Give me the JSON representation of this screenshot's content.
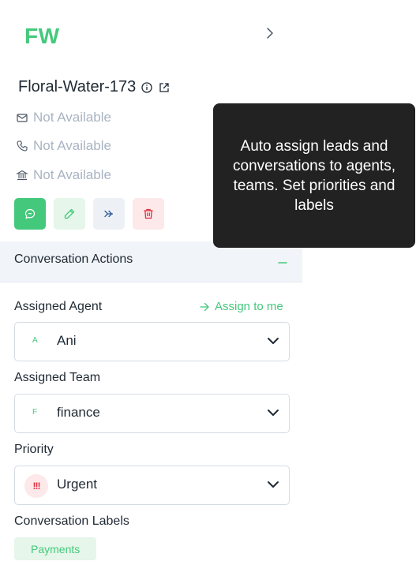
{
  "contact": {
    "initials": "FW",
    "name": "Floral-Water-173",
    "email": "Not Available",
    "phone": "Not Available",
    "company": "Not Available"
  },
  "section": {
    "title": "Conversation Actions"
  },
  "assigned_agent": {
    "label": "Assigned Agent",
    "assign_to_me": "Assign to me",
    "initial": "A",
    "value": "Ani"
  },
  "assigned_team": {
    "label": "Assigned Team",
    "initial": "F",
    "value": "finance"
  },
  "priority": {
    "label": "Priority",
    "badge": "!!!",
    "value": "Urgent"
  },
  "labels": {
    "title": "Conversation Labels",
    "items": [
      "Payments"
    ]
  },
  "tooltip": {
    "text": "Auto assign leads and conversations to agents, teams. Set priorities and labels"
  },
  "colors": {
    "accent": "#44c97c",
    "danger": "#e0303e",
    "tooltip_bg": "#222222"
  }
}
